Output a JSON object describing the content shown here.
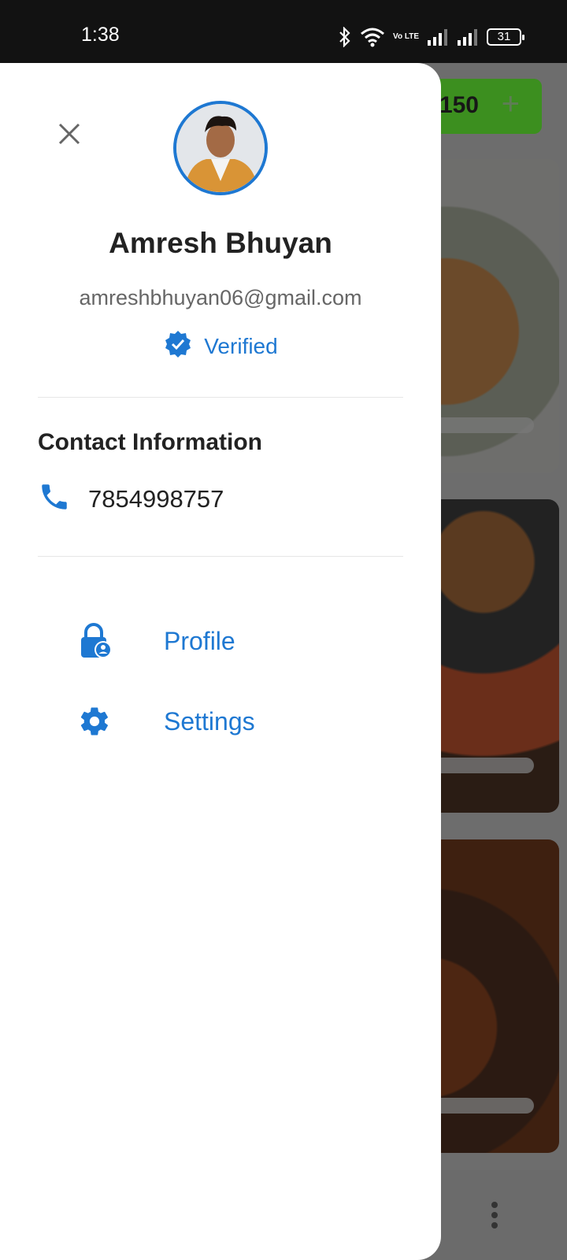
{
  "status_bar": {
    "time": "1:38",
    "battery": "31",
    "network": "Vo LTE"
  },
  "background_app": {
    "cart_amount": "150",
    "add_symbol": "+"
  },
  "drawer": {
    "user": {
      "name": "Amresh Bhuyan",
      "email": "amreshbhuyan06@gmail.com",
      "verified_label": "Verified"
    },
    "contact": {
      "title": "Contact Information",
      "phone": "7854998757"
    },
    "menu": [
      {
        "label": "Profile",
        "icon": "lock-person-icon"
      },
      {
        "label": "Settings",
        "icon": "gear-icon"
      }
    ]
  },
  "colors": {
    "accent": "#1e78d2",
    "cart_green": "#3c8f1f"
  }
}
